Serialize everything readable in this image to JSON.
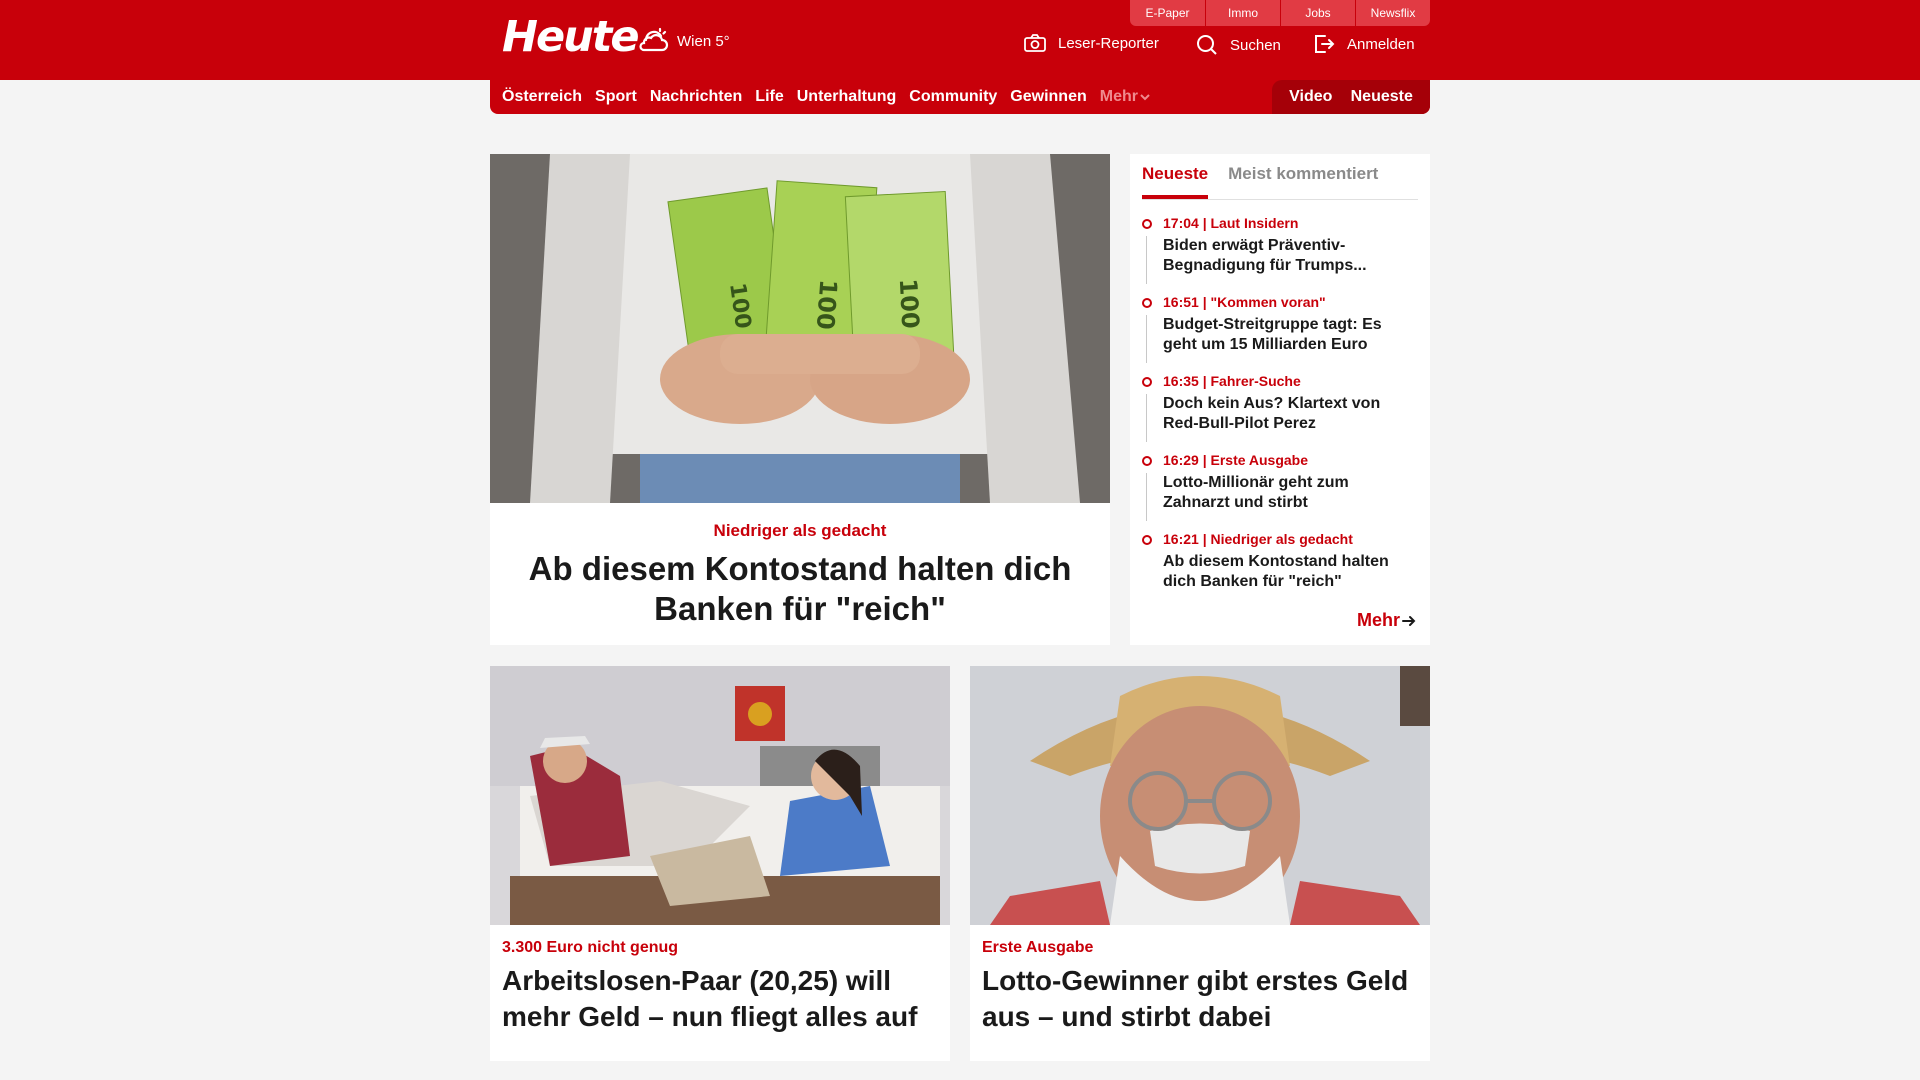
{
  "header": {
    "logo": "Heute",
    "weather": "Wien 5°",
    "top_links": [
      "E-Paper",
      "Immo",
      "Jobs",
      "Newsflix"
    ],
    "actions": [
      {
        "label": "Leser-Reporter",
        "icon": "camera-icon"
      },
      {
        "label": "Suchen",
        "icon": "search-icon"
      },
      {
        "label": "Anmelden",
        "icon": "login-icon"
      }
    ],
    "brand_color": "#c8000a"
  },
  "nav": {
    "items": [
      "Österreich",
      "Sport",
      "Nachrichten",
      "Life",
      "Unterhaltung",
      "Community",
      "Gewinnen"
    ],
    "more": "Mehr",
    "right": [
      "Video",
      "Neueste"
    ]
  },
  "hero": {
    "kicker": "Niedriger als gedacht",
    "title": "Ab diesem Kontostand halten dich Banken für \"reich\"",
    "image_alt": "Hände halten 100-Euro-Scheine"
  },
  "sidebar": {
    "tabs": [
      "Neueste",
      "Meist kommentiert"
    ],
    "items": [
      {
        "meta": "17:04 | Laut Insidern",
        "title": "Biden erwägt Präventiv-Begnadigung für Trumps..."
      },
      {
        "meta": "16:51 | \"Kommen voran\"",
        "title": "Budget-Streitgruppe tagt: Es geht um 15 Milliarden Euro"
      },
      {
        "meta": "16:35 | Fahrer-Suche",
        "title": "Doch kein Aus? Klartext von Red-Bull-Pilot Perez"
      },
      {
        "meta": "16:29 | Erste Ausgabe",
        "title": "Lotto-Millionär geht zum Zahnarzt und stirbt"
      },
      {
        "meta": "16:21 | Niedriger als gedacht",
        "title": "Ab diesem Kontostand halten dich Banken für \"reich\""
      }
    ],
    "more": "Mehr"
  },
  "cards": [
    {
      "kicker": "3.300 Euro nicht genug",
      "title": "Arbeitslosen-Paar (20,25) will mehr Geld – nun fliegt alles auf"
    },
    {
      "kicker": "Erste Ausgabe",
      "title": "Lotto-Gewinner gibt erstes Geld aus – und stirbt dabei"
    }
  ]
}
